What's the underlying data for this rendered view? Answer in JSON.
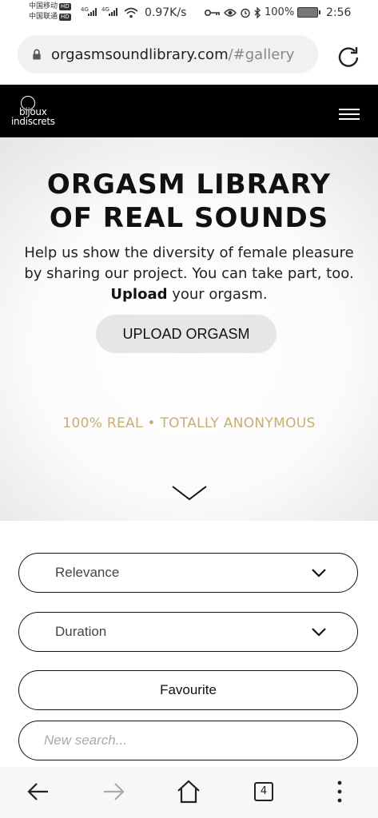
{
  "status_bar": {
    "carrier_1": "中国移动",
    "carrier_2": "中国联通",
    "network_1": "4G",
    "network_2": "4G",
    "hd_label": "HD",
    "speed": "0.97K/s",
    "battery": "100%",
    "time": "2:56"
  },
  "browser": {
    "url_host": "orgasmsoundlibrary.com",
    "url_fragment": "/#gallery"
  },
  "site": {
    "logo_line1": "bijoux",
    "logo_line2": "indiscrets"
  },
  "hero": {
    "title_line1": "ORGASM LIBRARY",
    "title_line2": "OF REAL SOUNDS",
    "lead_part1": "Help us show the diversity of female pleasure by sharing our project. You can take part, too. ",
    "lead_bold": "Upload",
    "lead_part2": " your orgasm.",
    "upload_button": "UPLOAD ORGASM",
    "tagline": "100% REAL • TOTALLY ANONYMOUS"
  },
  "filters": {
    "sort_selected": "Relevance",
    "duration_selected": "Duration",
    "favourite_button": "Favourite",
    "search_placeholder": "New search..."
  },
  "navbar": {
    "tab_count": "4"
  },
  "colors": {
    "header_bg": "#000000",
    "tagline_gold": "#c8ae74",
    "button_grey": "#e6e6e6"
  },
  "icons": [
    "lock-icon",
    "reload-icon",
    "hamburger-icon",
    "chevron-down-icon",
    "back-icon",
    "forward-icon",
    "home-icon",
    "tabs-icon",
    "more-icon",
    "wifi-icon",
    "key-icon",
    "eye-icon",
    "alarm-icon",
    "bluetooth-icon",
    "battery-icon"
  ]
}
